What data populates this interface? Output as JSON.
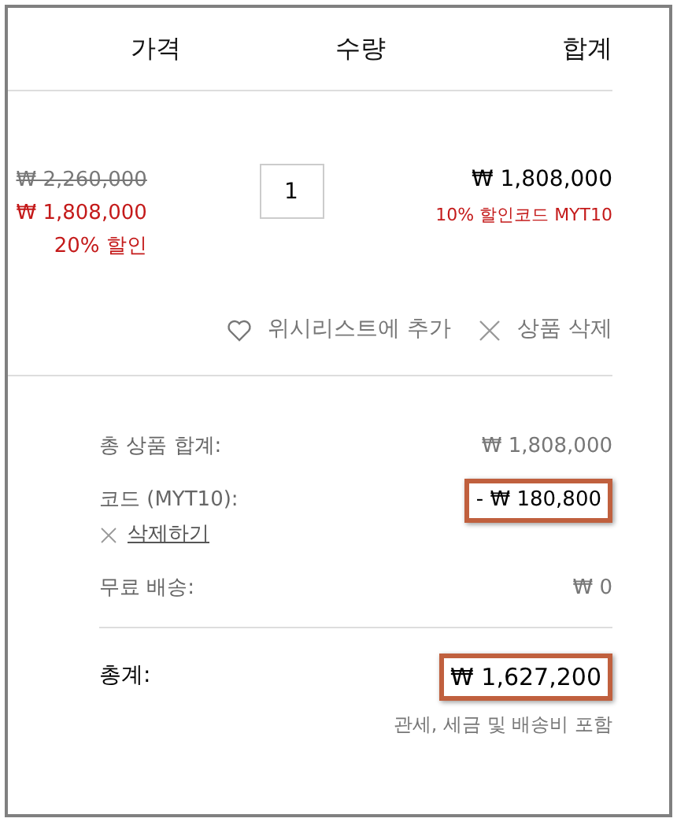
{
  "columns": [
    "가격",
    "수량",
    "합계"
  ],
  "item": {
    "original_price": "₩ 2,260,000",
    "sale_price": "₩ 1,808,000",
    "discount": "20% 할인",
    "quantity": "1",
    "total": "₩ 1,808,000",
    "code_note": "10% 할인코드 MYT10",
    "actions": [
      {
        "kind": "wishlist",
        "label": "위시리스트에 추가"
      },
      {
        "kind": "remove",
        "label": "상품 삭제"
      }
    ]
  },
  "summary": {
    "lines": [
      {
        "label": "총 상품 합계:",
        "value": "₩ 1,808,000",
        "highlighted": false
      },
      {
        "label": "코드 (MYT10):",
        "value": "- ₩ 180,800",
        "highlighted": true,
        "remove_link": "삭제하기"
      },
      {
        "label": "무료 배송:",
        "value": "₩ 0",
        "highlighted": false
      }
    ],
    "total": {
      "label": "총계:",
      "value": "₩ 1,627,200",
      "highlighted": true
    },
    "note": "관세, 세금 및 배송비 포함"
  }
}
